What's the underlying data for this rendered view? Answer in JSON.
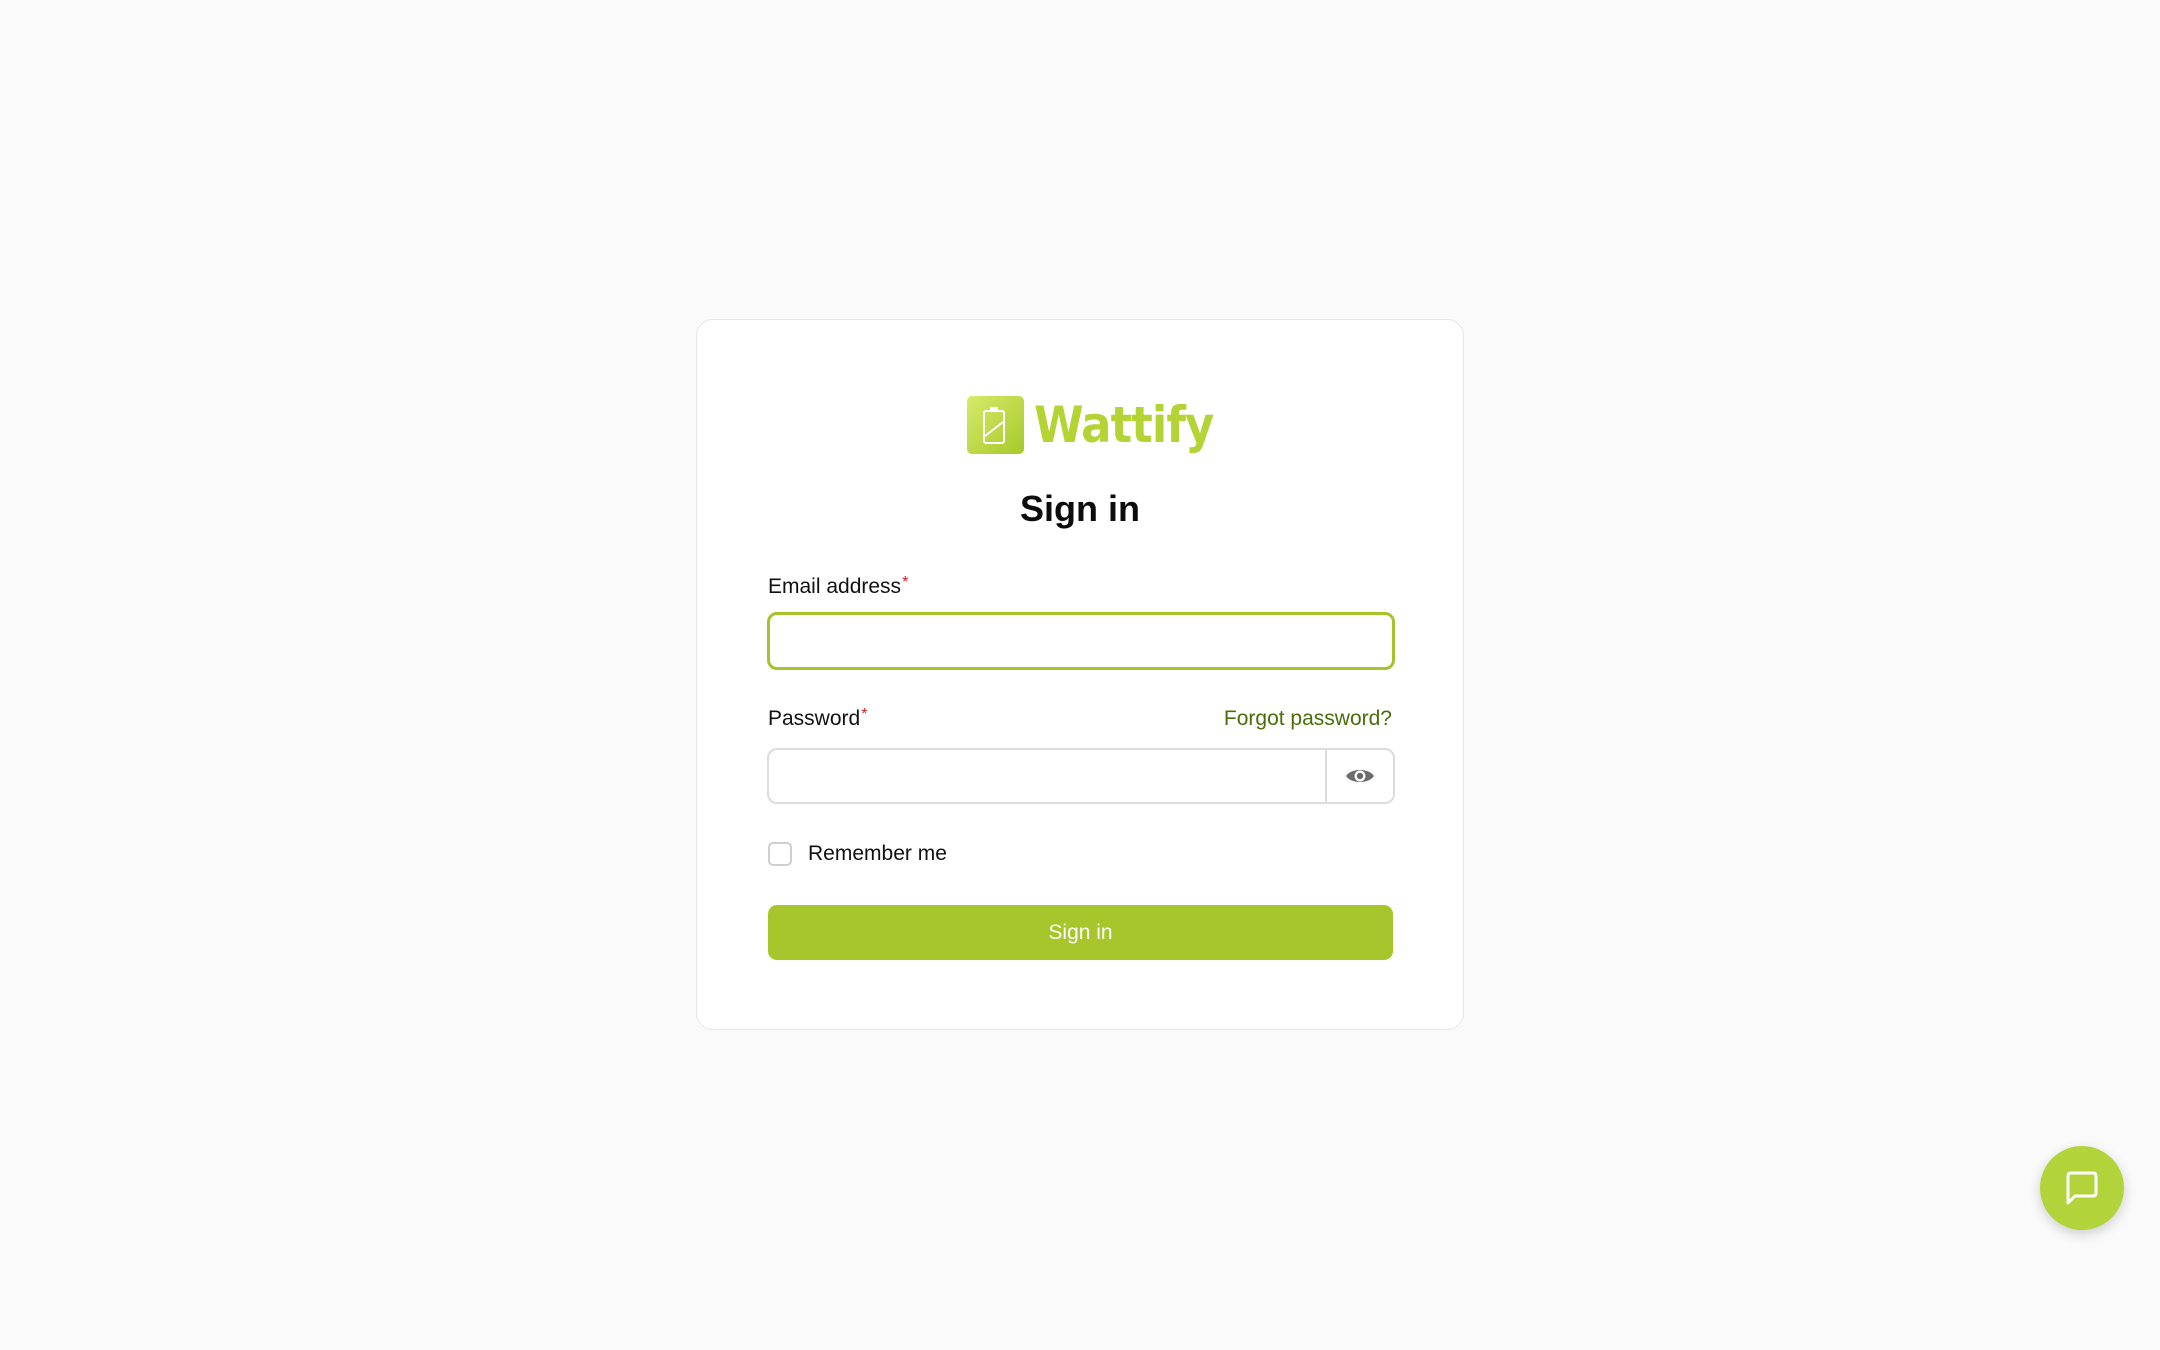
{
  "brand": {
    "name": "Wattify",
    "logo_icon": "battery-icon",
    "color": "#b3d434"
  },
  "form": {
    "title": "Sign in",
    "email": {
      "label": "Email address",
      "required_mark": "*",
      "value": "",
      "placeholder": ""
    },
    "password": {
      "label": "Password",
      "required_mark": "*",
      "value": "",
      "placeholder": "",
      "reveal_icon": "eye-icon"
    },
    "forgot_password_label": "Forgot password?",
    "remember_me": {
      "label": "Remember me",
      "checked": false
    },
    "submit_label": "Sign in"
  },
  "chat_button": {
    "icon": "chat-bubble-icon"
  },
  "colors": {
    "accent": "#a6c62b",
    "link": "#4a6d08",
    "required": "#d32020",
    "background": "#fafafa"
  }
}
